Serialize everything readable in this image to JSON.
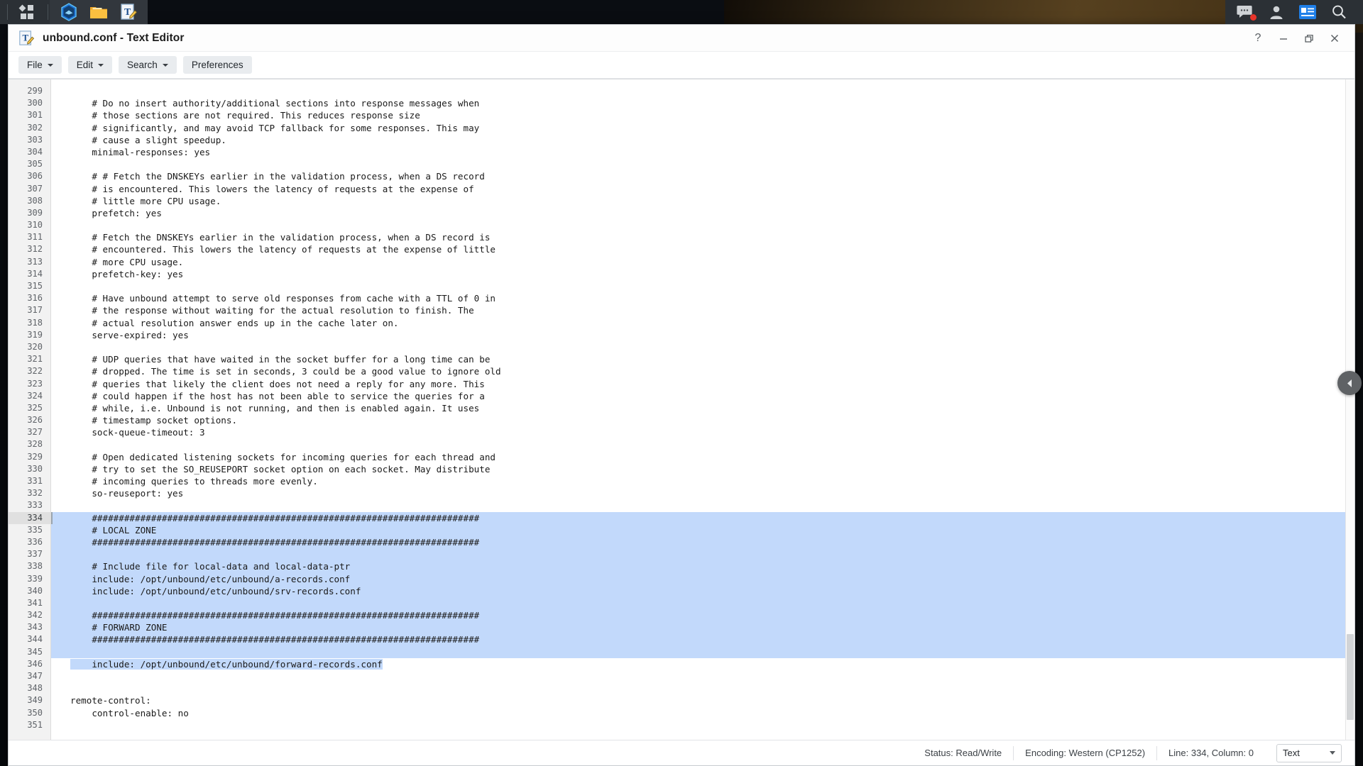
{
  "taskbar": {
    "left_icons": [
      {
        "name": "app-grid-icon",
        "label": "Applications"
      }
    ],
    "app_icons": [
      {
        "name": "hexagon-app-icon",
        "label": "Dev App"
      },
      {
        "name": "file-manager-icon",
        "label": "Files"
      },
      {
        "name": "text-editor-icon",
        "label": "Text Editor"
      }
    ],
    "right_icons": [
      {
        "name": "chat-icon",
        "label": "Messages",
        "badge": true
      },
      {
        "name": "user-icon",
        "label": "Account"
      },
      {
        "name": "news-feed-icon",
        "label": "Feed",
        "active": true
      },
      {
        "name": "search-icon",
        "label": "Search"
      }
    ]
  },
  "window": {
    "title": "unbound.conf - Text Editor",
    "controls": [
      {
        "name": "help-button",
        "glyph": "?"
      },
      {
        "name": "minimize-button",
        "glyph": "─"
      },
      {
        "name": "restore-button",
        "glyph": "❐"
      },
      {
        "name": "close-button",
        "glyph": "✕"
      }
    ]
  },
  "menubar": [
    {
      "label": "File",
      "caret": true
    },
    {
      "label": "Edit",
      "caret": true
    },
    {
      "label": "Search",
      "caret": true
    },
    {
      "label": "Preferences",
      "caret": false
    }
  ],
  "editor": {
    "first_line": 299,
    "current_line": 334,
    "selection_start_line": 334,
    "selection_end_line": 346,
    "selection_color": "#c2d9fb",
    "lines": [
      {
        "n": 299,
        "text": ""
      },
      {
        "n": 300,
        "text": "    # Do no insert authority/additional sections into response messages when"
      },
      {
        "n": 301,
        "text": "    # those sections are not required. This reduces response size"
      },
      {
        "n": 302,
        "text": "    # significantly, and may avoid TCP fallback for some responses. This may"
      },
      {
        "n": 303,
        "text": "    # cause a slight speedup."
      },
      {
        "n": 304,
        "text": "    minimal-responses: yes"
      },
      {
        "n": 305,
        "text": ""
      },
      {
        "n": 306,
        "text": "    # # Fetch the DNSKEYs earlier in the validation process, when a DS record"
      },
      {
        "n": 307,
        "text": "    # is encountered. This lowers the latency of requests at the expense of"
      },
      {
        "n": 308,
        "text": "    # little more CPU usage."
      },
      {
        "n": 309,
        "text": "    prefetch: yes"
      },
      {
        "n": 310,
        "text": ""
      },
      {
        "n": 311,
        "text": "    # Fetch the DNSKEYs earlier in the validation process, when a DS record is"
      },
      {
        "n": 312,
        "text": "    # encountered. This lowers the latency of requests at the expense of little"
      },
      {
        "n": 313,
        "text": "    # more CPU usage."
      },
      {
        "n": 314,
        "text": "    prefetch-key: yes"
      },
      {
        "n": 315,
        "text": ""
      },
      {
        "n": 316,
        "text": "    # Have unbound attempt to serve old responses from cache with a TTL of 0 in"
      },
      {
        "n": 317,
        "text": "    # the response without waiting for the actual resolution to finish. The"
      },
      {
        "n": 318,
        "text": "    # actual resolution answer ends up in the cache later on."
      },
      {
        "n": 319,
        "text": "    serve-expired: yes"
      },
      {
        "n": 320,
        "text": ""
      },
      {
        "n": 321,
        "text": "    # UDP queries that have waited in the socket buffer for a long time can be"
      },
      {
        "n": 322,
        "text": "    # dropped. The time is set in seconds, 3 could be a good value to ignore old"
      },
      {
        "n": 323,
        "text": "    # queries that likely the client does not need a reply for any more. This"
      },
      {
        "n": 324,
        "text": "    # could happen if the host has not been able to service the queries for a"
      },
      {
        "n": 325,
        "text": "    # while, i.e. Unbound is not running, and then is enabled again. It uses"
      },
      {
        "n": 326,
        "text": "    # timestamp socket options."
      },
      {
        "n": 327,
        "text": "    sock-queue-timeout: 3"
      },
      {
        "n": 328,
        "text": ""
      },
      {
        "n": 329,
        "text": "    # Open dedicated listening sockets for incoming queries for each thread and"
      },
      {
        "n": 330,
        "text": "    # try to set the SO_REUSEPORT socket option on each socket. May distribute"
      },
      {
        "n": 331,
        "text": "    # incoming queries to threads more evenly."
      },
      {
        "n": 332,
        "text": "    so-reuseport: yes"
      },
      {
        "n": 333,
        "text": ""
      },
      {
        "n": 334,
        "text": "    ########################################################################"
      },
      {
        "n": 335,
        "text": "    # LOCAL ZONE"
      },
      {
        "n": 336,
        "text": "    ########################################################################"
      },
      {
        "n": 337,
        "text": ""
      },
      {
        "n": 338,
        "text": "    # Include file for local-data and local-data-ptr"
      },
      {
        "n": 339,
        "text": "    include: /opt/unbound/etc/unbound/a-records.conf"
      },
      {
        "n": 340,
        "text": "    include: /opt/unbound/etc/unbound/srv-records.conf"
      },
      {
        "n": 341,
        "text": ""
      },
      {
        "n": 342,
        "text": "    ########################################################################"
      },
      {
        "n": 343,
        "text": "    # FORWARD ZONE"
      },
      {
        "n": 344,
        "text": "    ########################################################################"
      },
      {
        "n": 345,
        "text": ""
      },
      {
        "n": 346,
        "text": "    include: /opt/unbound/etc/unbound/forward-records.conf"
      },
      {
        "n": 347,
        "text": ""
      },
      {
        "n": 348,
        "text": ""
      },
      {
        "n": 349,
        "text": "remote-control:"
      },
      {
        "n": 350,
        "text": "    control-enable: no"
      },
      {
        "n": 351,
        "text": ""
      }
    ]
  },
  "statusbar": {
    "status": "Status: Read/Write",
    "encoding": "Encoding: Western (CP1252)",
    "position": "Line: 334, Column: 0",
    "language": "Text"
  },
  "side_tab": {
    "name": "panel-expand-handle",
    "glyph": "◀"
  }
}
